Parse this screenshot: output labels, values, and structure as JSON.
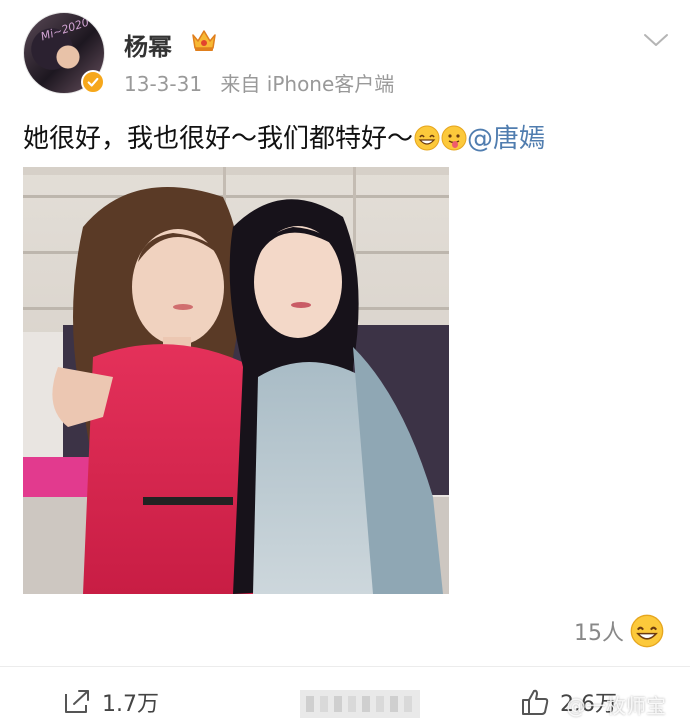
{
  "header": {
    "username": "杨幂",
    "avatar_text": "Mi~2020",
    "date": "13-3-31",
    "source": "来自 iPhone客户端",
    "icons": [
      "verified-icon",
      "crown-icon",
      "chevron-down-icon"
    ]
  },
  "post": {
    "text": "她很好，我也很好～我们都特好～",
    "mention": "@唐嫣",
    "emojis": [
      "grin-emoji",
      "tongue-emoji"
    ]
  },
  "reactions": {
    "count": "15人",
    "emoji": "grin-emoji"
  },
  "actions": {
    "share_count": "1.7万",
    "like_count": "2.6万"
  },
  "watermark": "@一枚师宝",
  "colors": {
    "mention": "#507daf",
    "verified": "#f6a71b",
    "meta": "#999999"
  }
}
